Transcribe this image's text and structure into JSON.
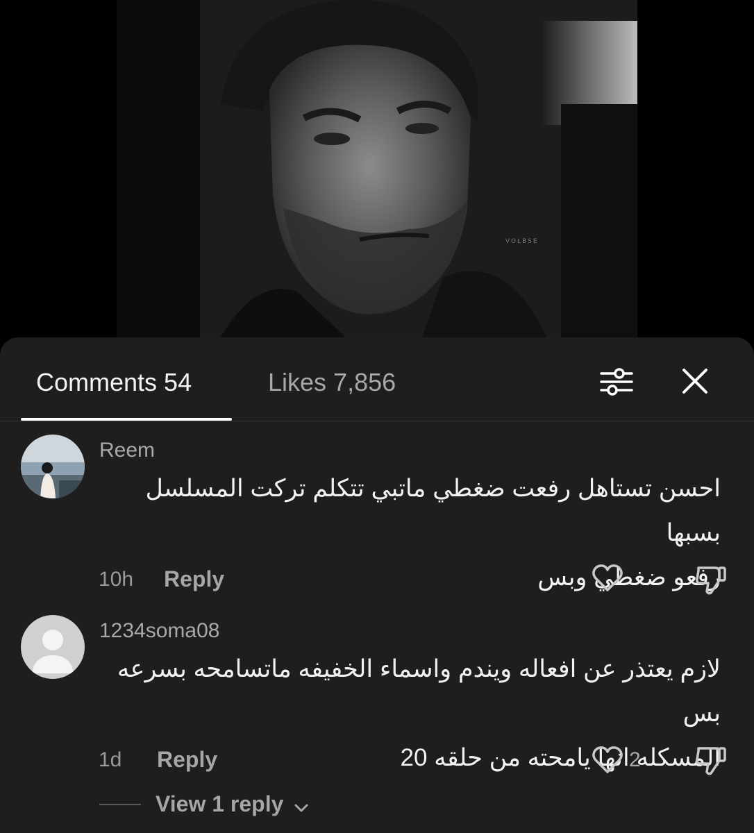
{
  "video": {
    "watermark": "VOLBSE"
  },
  "tabs": {
    "comments_label": "Comments 54",
    "likes_label": "Likes 7,856"
  },
  "icons": {
    "filter": "filter-sliders-icon",
    "close": "close-icon",
    "like": "heart-icon",
    "dislike": "thumbs-down-icon",
    "chevron": "chevron-down-icon"
  },
  "comments": [
    {
      "username": "Reem",
      "line1": "احسن تستاهل رفعت ضغطي ماتبي تتكلم تركت المسلسل بسبها",
      "line2": "رفعو ضغطي وبس",
      "time": "10h",
      "reply_label": "Reply",
      "likes": ""
    },
    {
      "username": "1234soma08",
      "line1": "لازم يعتذر عن افعاله ويندم واسماء الخفيفه ماتسامحه بسرعه بس",
      "line2": "المسكله انها يامحته من حلقه 20",
      "time": "1d",
      "reply_label": "Reply",
      "likes": "2",
      "view_replies_label": "View 1 reply"
    }
  ],
  "colors": {
    "sheet_bg": "#1e1e1e",
    "active_tab": "#f5f5f5",
    "muted_text": "#a9a9a9"
  }
}
